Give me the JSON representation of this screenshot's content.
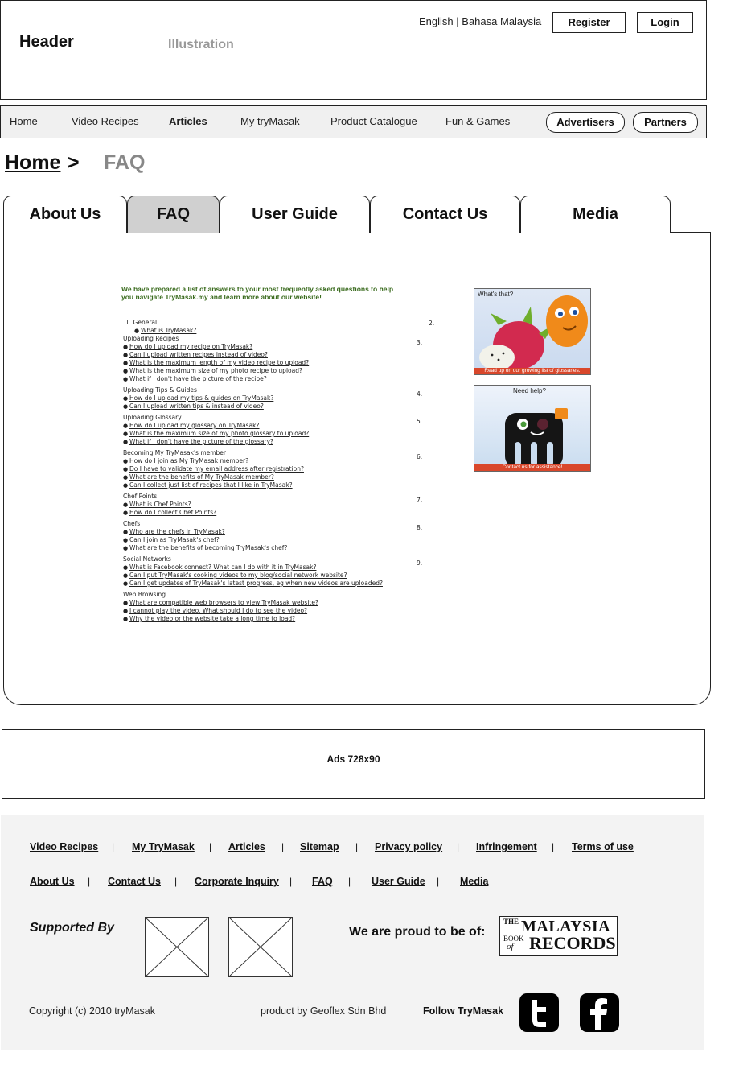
{
  "header": {
    "title": "Header",
    "illustration": "Illustration",
    "lang_english": "English",
    "lang_sep": "|",
    "lang_malay": "Bahasa Malaysia",
    "register": "Register",
    "login": "Login"
  },
  "nav": {
    "items": [
      "Home",
      "Video Recipes",
      "Articles",
      "My tryMasak",
      "Product Catalogue",
      "Fun & Games"
    ],
    "active": "Articles",
    "advertisers": "Advertisers",
    "partners": "Partners"
  },
  "breadcrumb": {
    "home": "Home",
    "sep": ">",
    "current": "FAQ"
  },
  "tabs": [
    "About Us",
    "FAQ",
    "User Guide",
    "Contact Us",
    "Media"
  ],
  "faq": {
    "intro": "We have prepared a list of answers to your most frequently asked questions to help you navigate TryMasak.my and learn more about our website!",
    "sections": [
      {
        "title": "1.  General",
        "questions": [
          "What is TryMasak?"
        ]
      },
      {
        "title": "Uploading Recipes",
        "questions": [
          "How do I upload my recipe on TryMasak?",
          "Can I upload written recipes instead of video?",
          "What is the maximum length of my video recipe to upload?",
          "What is the maximum size of my photo recipe to upload?",
          "What if I don't have the picture of the recipe?"
        ]
      },
      {
        "title": "Uploading Tips & Guides",
        "questions": [
          "How do I upload my tips & guides on TryMasak?",
          "Can I upload written tips & instead of video?"
        ]
      },
      {
        "title": "Uploading Glossary",
        "questions": [
          "How do I upload my glossary on TryMasak?",
          "What is the maximum size of my photo glossary to upload?",
          "What if I don't have the picture of the glossary?"
        ]
      },
      {
        "title": "Becoming My TryMasak's member",
        "questions": [
          "How do I join as My TryMasak member?",
          "Do I have to validate my email address after registration?",
          "What are the benefits of My TryMasak member?",
          "Can I collect just list of recipes that I like in TryMasak?"
        ]
      },
      {
        "title": "Chef Points",
        "questions": [
          "What is Chef Points?",
          "How do I collect Chef Points?"
        ]
      },
      {
        "title": "Chefs",
        "questions": [
          "Who are the chefs in TryMasak?",
          "Can I join as TryMasak's chef?",
          "What are the benefits of becoming TryMasak's chef?"
        ]
      },
      {
        "title": "Social Networks",
        "questions": [
          "What is Facebook connect? What can I do with it in TryMasak?",
          "Can I put TryMasak's cooking videos to my blog/social network website?",
          "Can I get updates of TryMasak's latest progress, eg when new videos are uploaded?"
        ]
      },
      {
        "title": "Web Browsing",
        "questions": [
          "What are compatible web browsers to view TryMasak website?",
          "I cannot play the video. What should I do to see the video?",
          "Why the video or the website take a long time to load?"
        ]
      }
    ],
    "numbers": [
      "2.",
      "3.",
      "4.",
      "5.",
      "6.",
      "7.",
      "8.",
      "9."
    ]
  },
  "promos": [
    {
      "heading": "What's that?",
      "caption": "Read up on our growing list of glossaries."
    },
    {
      "heading": "Need help?",
      "caption": "Contact us for assistance!"
    }
  ],
  "ads": {
    "label": "Ads 728x90"
  },
  "footer": {
    "row1": [
      "Video Recipes",
      "My TryMasak",
      "Articles",
      "Sitemap",
      "Privacy policy",
      "Infringement",
      "Terms of use"
    ],
    "row2": [
      "About Us",
      "Contact Us",
      "Corporate Inquiry",
      "FAQ",
      "User Guide",
      "Media"
    ],
    "sep": "|",
    "supported_by": "Supported By",
    "proud": "We are proud to be of:",
    "mbr_logo": {
      "line1": "THE",
      "line2": "MALAYSIA",
      "line3": "BOOK",
      "line4": "of",
      "line5": "RECORDS"
    },
    "copyright": "Copyright (c) 2010 tryMasak",
    "product_by": "product by Geoflex Sdn Bhd",
    "follow": "Follow TryMasak"
  }
}
